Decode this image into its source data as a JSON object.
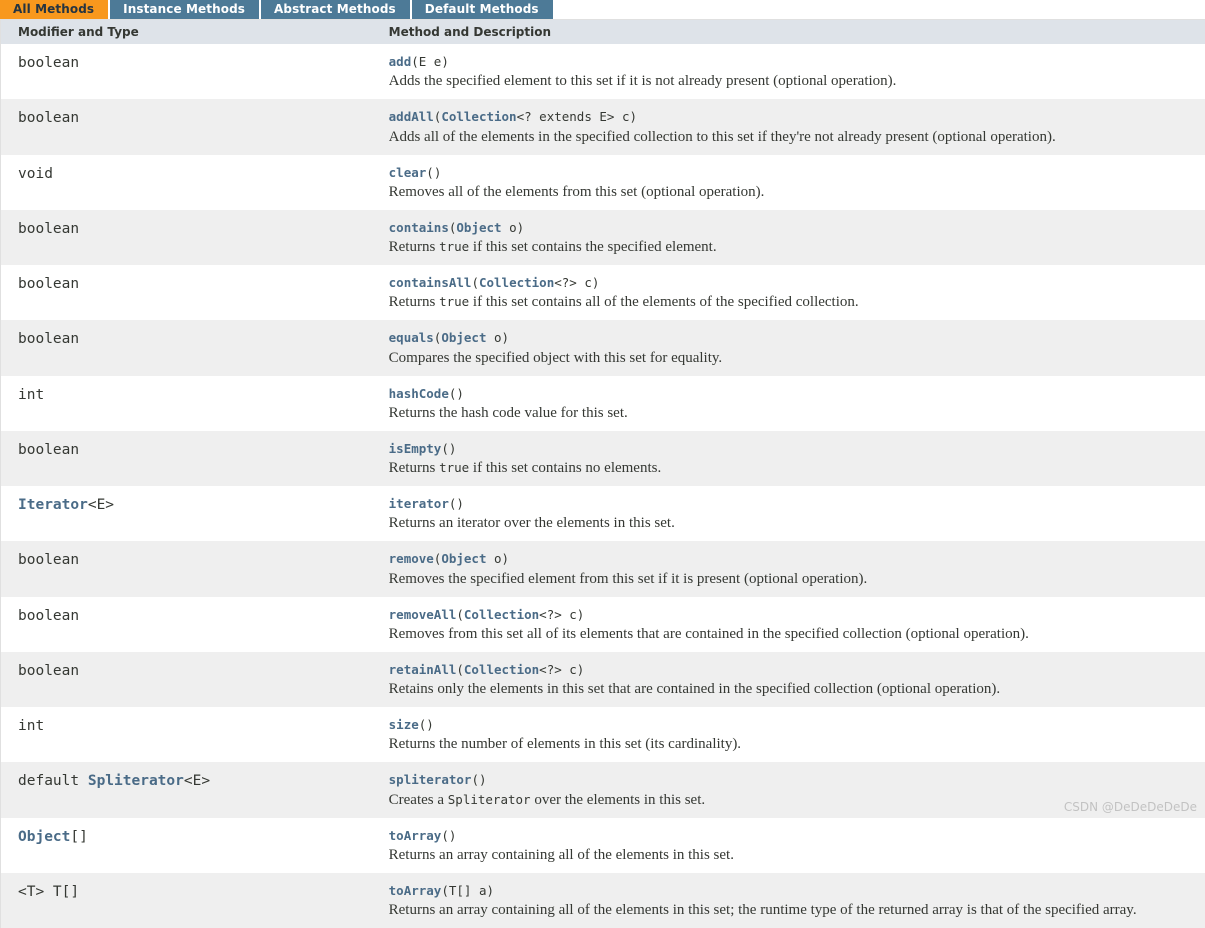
{
  "tabs": [
    {
      "label": "All Methods",
      "state": "active"
    },
    {
      "label": "Instance Methods",
      "state": "inactive"
    },
    {
      "label": "Abstract Methods",
      "state": "inactive"
    },
    {
      "label": "Default Methods",
      "state": "inactive"
    }
  ],
  "columns": {
    "modifier_and_type": "Modifier and Type",
    "method_and_description": "Method and Description"
  },
  "colors": {
    "tab_active_bg": "#f8981d",
    "tab_inactive_bg": "#4d7a97",
    "header_bg": "#dee3e9",
    "row_alt_bg": "#efefef",
    "link": "#4a6b87",
    "text": "#353833"
  },
  "rows": [
    {
      "type_prefix": "",
      "type_link": "",
      "type_plain": "boolean",
      "method_name": "add",
      "method_args_pre": "(",
      "method_arg_link": "",
      "method_args_post": "E e)",
      "description_pre": "Adds the specified element to this set if it is not already present (optional operation).",
      "description_code": "",
      "description_post": ""
    },
    {
      "type_prefix": "",
      "type_link": "",
      "type_plain": "boolean",
      "method_name": "addAll",
      "method_args_pre": "(",
      "method_arg_link": "Collection",
      "method_args_post": "<? extends E> c)",
      "description_pre": "Adds all of the elements in the specified collection to this set if they're not already present (optional operation).",
      "description_code": "",
      "description_post": ""
    },
    {
      "type_prefix": "",
      "type_link": "",
      "type_plain": "void",
      "method_name": "clear",
      "method_args_pre": "(",
      "method_arg_link": "",
      "method_args_post": ")",
      "description_pre": "Removes all of the elements from this set (optional operation).",
      "description_code": "",
      "description_post": ""
    },
    {
      "type_prefix": "",
      "type_link": "",
      "type_plain": "boolean",
      "method_name": "contains",
      "method_args_pre": "(",
      "method_arg_link": "Object",
      "method_args_post": " o)",
      "description_pre": "Returns ",
      "description_code": "true",
      "description_post": " if this set contains the specified element."
    },
    {
      "type_prefix": "",
      "type_link": "",
      "type_plain": "boolean",
      "method_name": "containsAll",
      "method_args_pre": "(",
      "method_arg_link": "Collection",
      "method_args_post": "<?> c)",
      "description_pre": "Returns ",
      "description_code": "true",
      "description_post": " if this set contains all of the elements of the specified collection."
    },
    {
      "type_prefix": "",
      "type_link": "",
      "type_plain": "boolean",
      "method_name": "equals",
      "method_args_pre": "(",
      "method_arg_link": "Object",
      "method_args_post": " o)",
      "description_pre": "Compares the specified object with this set for equality.",
      "description_code": "",
      "description_post": ""
    },
    {
      "type_prefix": "",
      "type_link": "",
      "type_plain": "int",
      "method_name": "hashCode",
      "method_args_pre": "(",
      "method_arg_link": "",
      "method_args_post": ")",
      "description_pre": "Returns the hash code value for this set.",
      "description_code": "",
      "description_post": ""
    },
    {
      "type_prefix": "",
      "type_link": "",
      "type_plain": "boolean",
      "method_name": "isEmpty",
      "method_args_pre": "(",
      "method_arg_link": "",
      "method_args_post": ")",
      "description_pre": "Returns ",
      "description_code": "true",
      "description_post": " if this set contains no elements."
    },
    {
      "type_prefix": "",
      "type_link": "Iterator",
      "type_plain": "<E>",
      "method_name": "iterator",
      "method_args_pre": "(",
      "method_arg_link": "",
      "method_args_post": ")",
      "description_pre": "Returns an iterator over the elements in this set.",
      "description_code": "",
      "description_post": ""
    },
    {
      "type_prefix": "",
      "type_link": "",
      "type_plain": "boolean",
      "method_name": "remove",
      "method_args_pre": "(",
      "method_arg_link": "Object",
      "method_args_post": " o)",
      "description_pre": "Removes the specified element from this set if it is present (optional operation).",
      "description_code": "",
      "description_post": ""
    },
    {
      "type_prefix": "",
      "type_link": "",
      "type_plain": "boolean",
      "method_name": "removeAll",
      "method_args_pre": "(",
      "method_arg_link": "Collection",
      "method_args_post": "<?> c)",
      "description_pre": "Removes from this set all of its elements that are contained in the specified collection (optional operation).",
      "description_code": "",
      "description_post": ""
    },
    {
      "type_prefix": "",
      "type_link": "",
      "type_plain": "boolean",
      "method_name": "retainAll",
      "method_args_pre": "(",
      "method_arg_link": "Collection",
      "method_args_post": "<?> c)",
      "description_pre": "Retains only the elements in this set that are contained in the specified collection (optional operation).",
      "description_code": "",
      "description_post": ""
    },
    {
      "type_prefix": "",
      "type_link": "",
      "type_plain": "int",
      "method_name": "size",
      "method_args_pre": "(",
      "method_arg_link": "",
      "method_args_post": ")",
      "description_pre": "Returns the number of elements in this set (its cardinality).",
      "description_code": "",
      "description_post": ""
    },
    {
      "type_prefix": "default ",
      "type_link": "Spliterator",
      "type_plain": "<E>",
      "method_name": "spliterator",
      "method_args_pre": "(",
      "method_arg_link": "",
      "method_args_post": ")",
      "description_pre": "Creates a ",
      "description_code": "Spliterator",
      "description_post": " over the elements in this set."
    },
    {
      "type_prefix": "",
      "type_link": "Object",
      "type_plain": "[]",
      "method_name": "toArray",
      "method_args_pre": "(",
      "method_arg_link": "",
      "method_args_post": ")",
      "description_pre": "Returns an array containing all of the elements in this set.",
      "description_code": "",
      "description_post": ""
    },
    {
      "type_prefix": "<T> ",
      "type_link": "",
      "type_plain": "T[]",
      "method_name": "toArray",
      "method_args_pre": "(",
      "method_arg_link": "",
      "method_args_post": "T[] a)",
      "description_pre": "Returns an array containing all of the elements in this set; the runtime type of the returned array is that of the specified array.",
      "description_code": "",
      "description_post": ""
    }
  ],
  "watermark": {
    "text": "CSDN @DeDeDeDeDe"
  }
}
